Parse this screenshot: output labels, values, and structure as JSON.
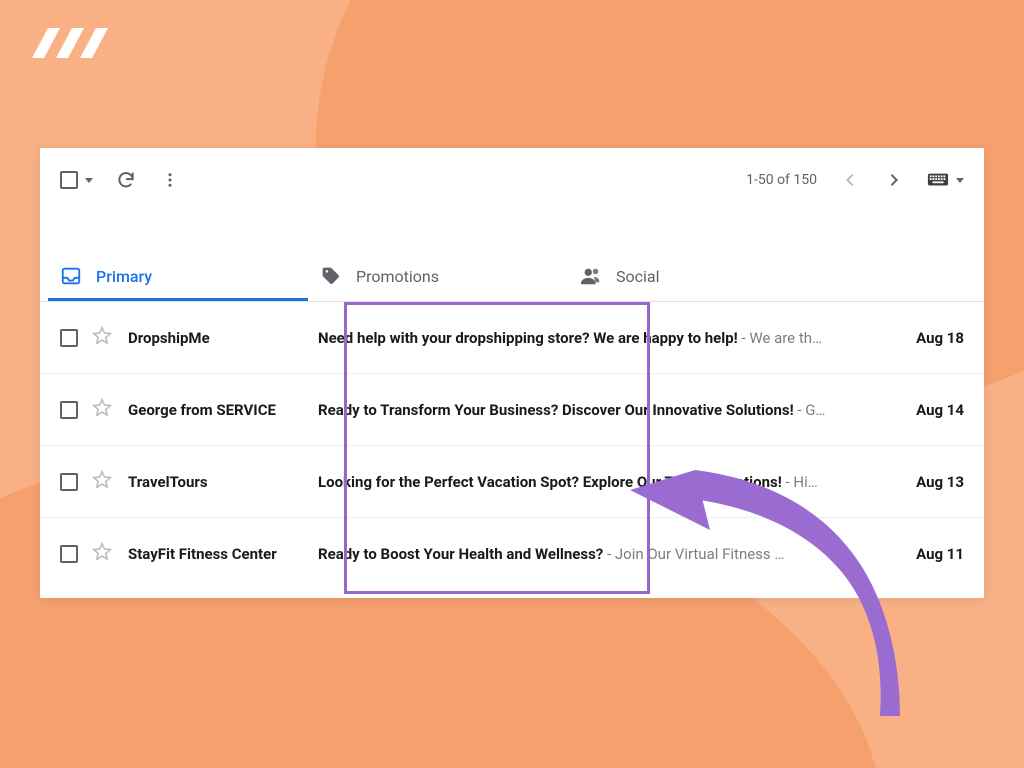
{
  "toolbar": {
    "pagination_text": "1-50 of 150"
  },
  "tabs": [
    {
      "label": "Primary"
    },
    {
      "label": "Promotions"
    },
    {
      "label": "Social"
    }
  ],
  "emails": [
    {
      "sender": "DropshipMe",
      "subject": "Need help with your dropshipping store? We are happy to help!",
      "snippet": " - We are th…",
      "date": "Aug 18"
    },
    {
      "sender": "George from SERVICE",
      "subject": "Ready to Transform Your Business? Discover Our Innovative Solutions!",
      "snippet": " - G…",
      "date": "Aug 14"
    },
    {
      "sender": "TravelTours",
      "subject": "Looking for the Perfect Vacation Spot? Explore Our Top Destinations!",
      "snippet": " - Hi…",
      "date": "Aug 13"
    },
    {
      "sender": "StayFit Fitness Center",
      "subject": "Ready to Boost Your Health and Wellness?",
      "snippet": " - Join Our Virtual Fitness …",
      "date": "Aug 11"
    }
  ],
  "colors": {
    "accent_blue": "#1a73e8",
    "annotation_purple": "#9966cc",
    "bg_light": "#f8b084",
    "bg_dark": "#f6a06e"
  }
}
